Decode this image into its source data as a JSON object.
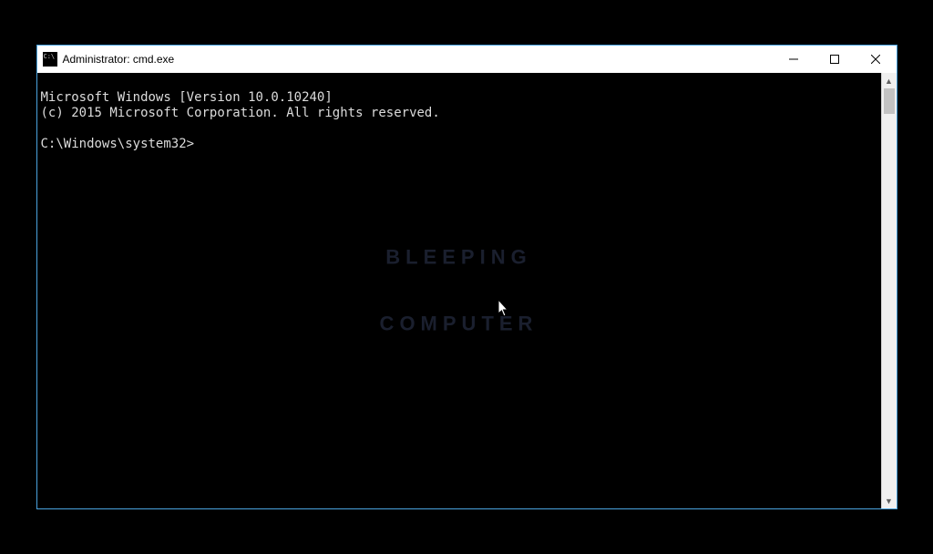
{
  "window": {
    "title": "Administrator: cmd.exe"
  },
  "console": {
    "line1": "Microsoft Windows [Version 10.0.10240]",
    "line2": "(c) 2015 Microsoft Corporation. All rights reserved.",
    "blank": "",
    "prompt": "C:\\Windows\\system32>"
  },
  "watermark": {
    "line1": "BLEEPING",
    "line2": "COMPUTER"
  }
}
